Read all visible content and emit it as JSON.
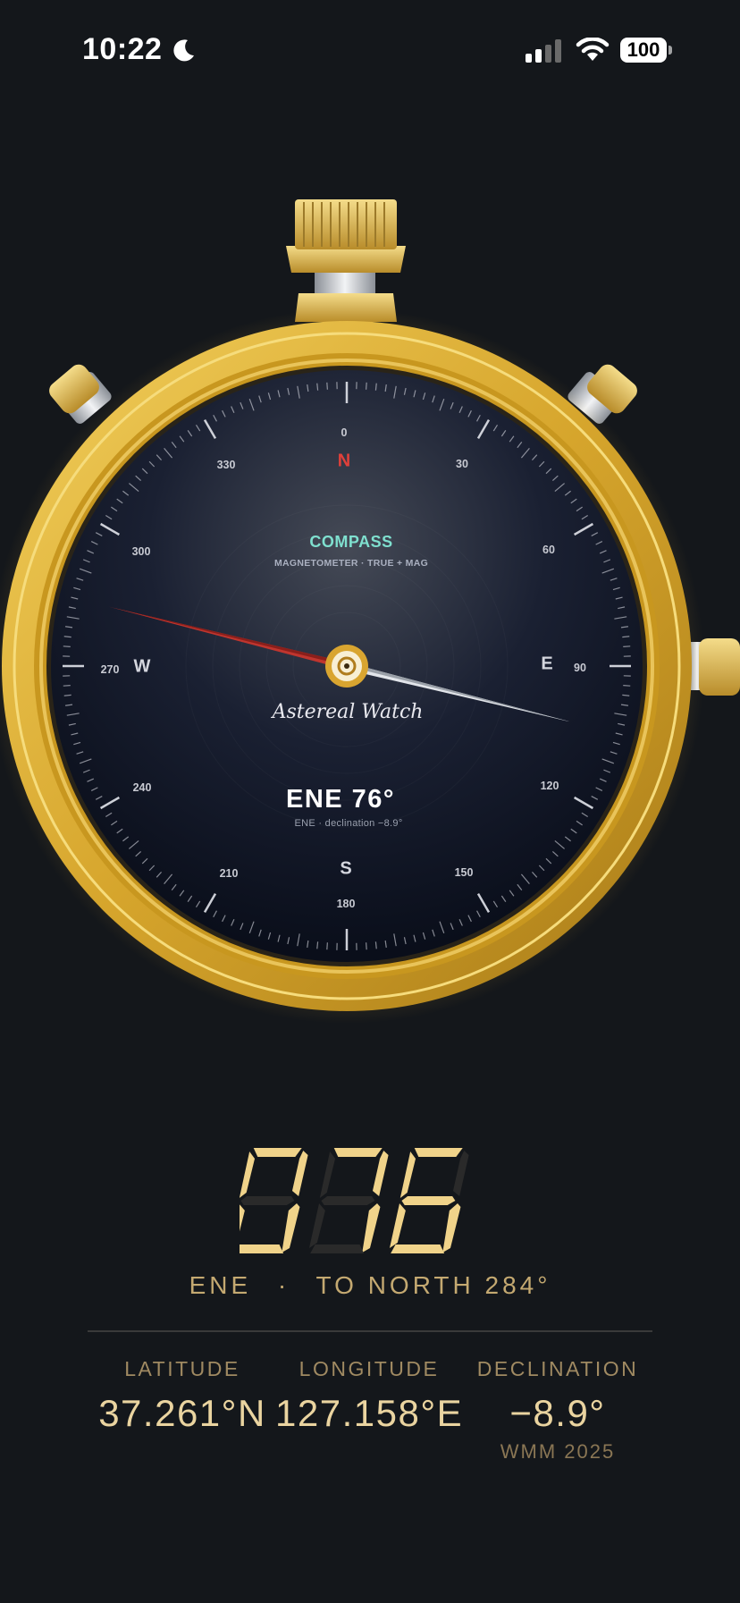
{
  "status_bar": {
    "time": "10:22",
    "battery": "100",
    "icons": [
      "moon-icon",
      "cellular-signal-icon",
      "wifi-icon",
      "battery-icon"
    ]
  },
  "compass_face": {
    "title": "COMPASS",
    "subtitle": "MAGNETOMETER · TRUE + MAG",
    "brand": "Astereal Watch",
    "heading_label": "ENE 76°",
    "heading_sub": "ENE · declination −8.9°",
    "cardinals": {
      "n": "N",
      "e": "E",
      "s": "S",
      "w": "W"
    },
    "degree_labels": {
      "d0": "0",
      "d30": "30",
      "d60": "60",
      "d90": "90",
      "d120": "120",
      "d150": "150",
      "d180": "180",
      "d210": "210",
      "d240": "240",
      "d270": "270",
      "d300": "300",
      "d330": "330"
    },
    "needle_heading_deg": 76,
    "colors": {
      "case": "#d4a62a",
      "dial": "#0c1222",
      "needle_north": "#c0352e",
      "needle_south": "#d8dbe2",
      "accent": "#7fe0cf"
    }
  },
  "readout": {
    "heading_digits": "076",
    "direction": "ENE",
    "separator": "·",
    "to_north": "TO NORTH 284°",
    "color": "#f0d38a"
  },
  "info": {
    "latitude": {
      "label": "LATITUDE",
      "value": "37.261°N"
    },
    "longitude": {
      "label": "LONGITUDE",
      "value": "127.158°E"
    },
    "declination": {
      "label": "DECLINATION",
      "value": "−8.9°",
      "note": "WMM 2025"
    }
  }
}
